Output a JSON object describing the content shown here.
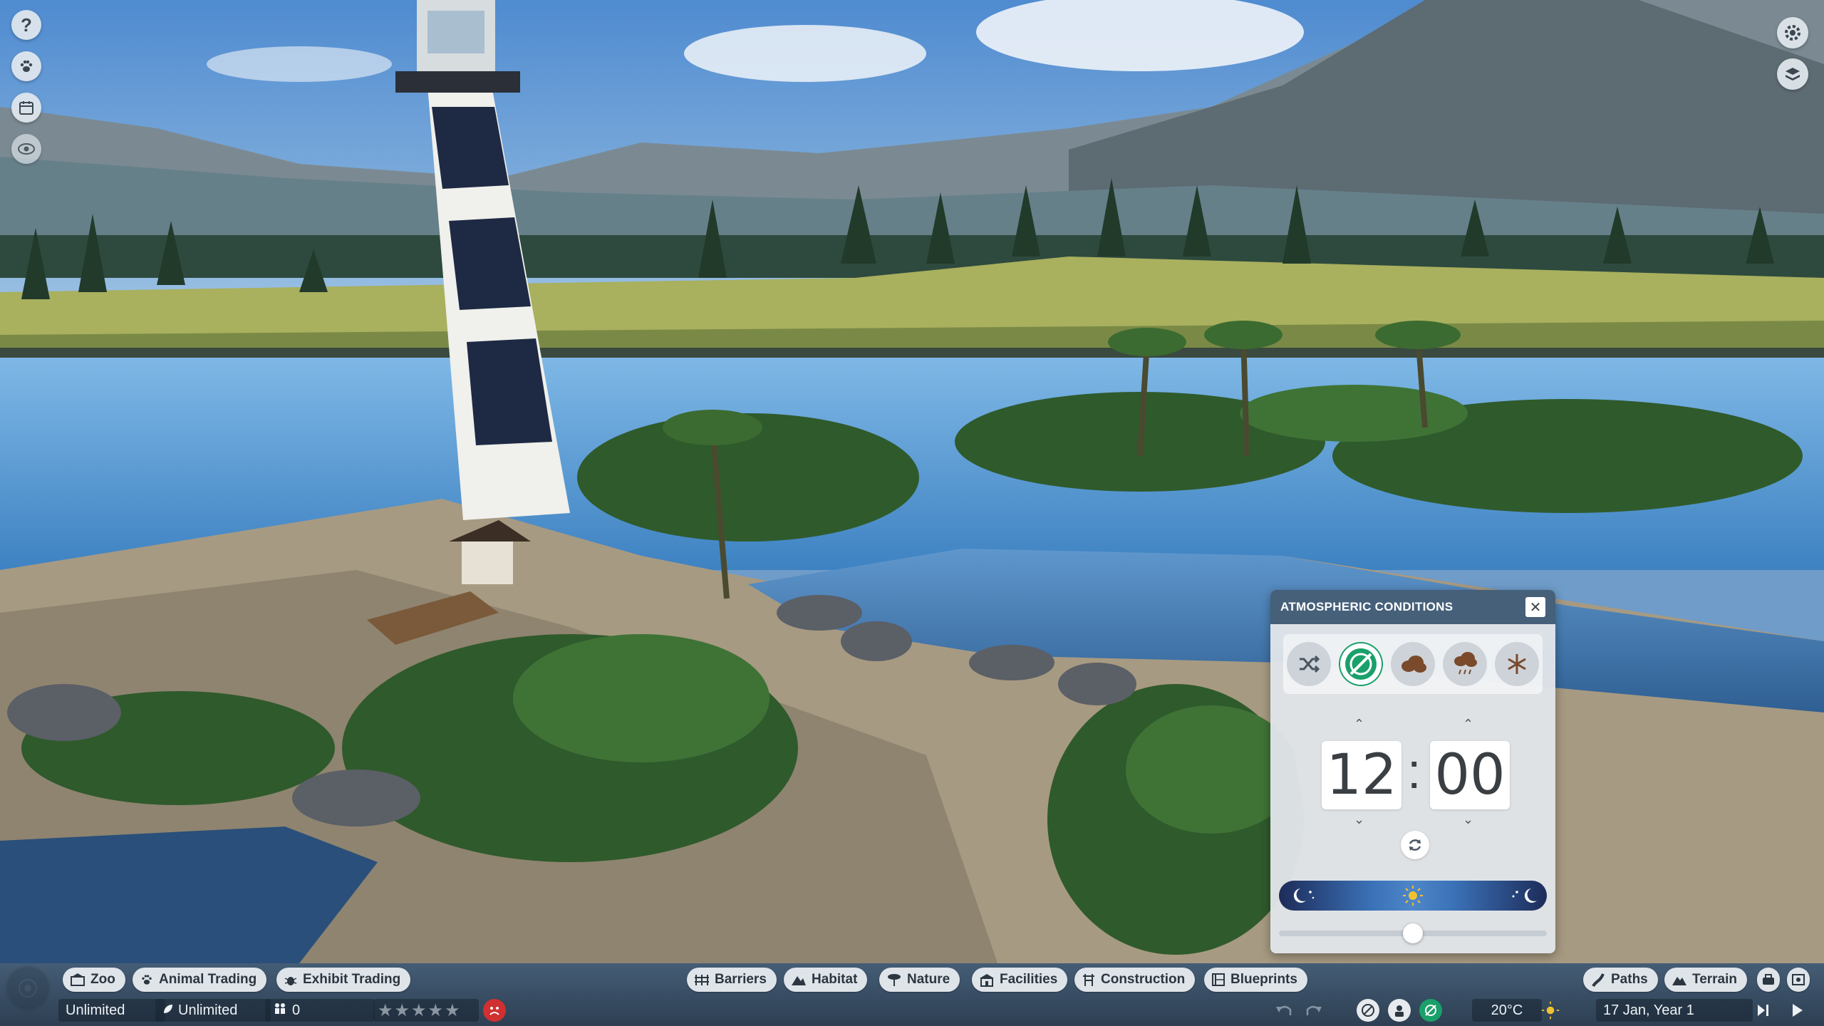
{
  "atmospheric": {
    "title": "ATMOSPHERIC CONDITIONS",
    "weather_options": [
      {
        "name": "random",
        "active": false
      },
      {
        "name": "clear",
        "active": true
      },
      {
        "name": "cloudy",
        "active": false
      },
      {
        "name": "rain",
        "active": false
      },
      {
        "name": "snow",
        "active": false
      }
    ],
    "hours": "12",
    "minutes": "00",
    "day_progress": 0.5
  },
  "left_toolbar": [
    "help-icon",
    "animal-paw-icon",
    "calendar-icon",
    "visibility-eye-icon"
  ],
  "right_toolbar": [
    "settings-gear-icon",
    "guidebook-icon"
  ],
  "bottom_bar": {
    "left_menu": [
      {
        "label": "Zoo",
        "icon": "zoo-icon"
      },
      {
        "label": "Animal Trading",
        "icon": "paw-icon"
      },
      {
        "label": "Exhibit Trading",
        "icon": "bug-icon"
      }
    ],
    "center_menu": [
      {
        "label": "Barriers",
        "icon": "barrier-icon"
      },
      {
        "label": "Habitat",
        "icon": "habitat-icon"
      },
      {
        "label": "Nature",
        "icon": "nature-icon"
      },
      {
        "label": "Facilities",
        "icon": "facilities-icon"
      },
      {
        "label": "Construction",
        "icon": "construction-icon"
      },
      {
        "label": "Blueprints",
        "icon": "blueprints-icon"
      }
    ],
    "right_menu": [
      {
        "label": "Paths",
        "icon": "paths-icon"
      },
      {
        "label": "Terrain",
        "icon": "terrain-icon"
      }
    ],
    "money": "Unlimited",
    "research": "Unlimited",
    "guests": "0",
    "rating_stars": 0,
    "temperature": "20°C",
    "date": "17 Jan, Year 1"
  },
  "colors": {
    "accent_green": "#1aa06a",
    "header_blue": "#46607a",
    "unhappy_red": "#d03030"
  }
}
